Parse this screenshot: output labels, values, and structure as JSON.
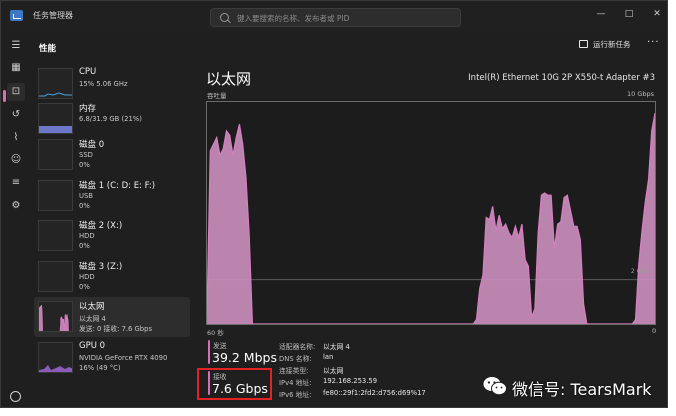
{
  "titlebar": {
    "title": "任务管理器",
    "search_placeholder": "键入要搜索的名称、发布者或 PID",
    "minimize": "—",
    "maximize": "□",
    "close": "✕"
  },
  "header": {
    "title": "性能",
    "run_task": "运行新任务",
    "more": "···"
  },
  "nav": {
    "icons": [
      "menu-icon",
      "processes-icon",
      "performance-icon",
      "app-history-icon",
      "startup-apps-icon",
      "users-icon",
      "details-icon",
      "services-icon",
      "settings-icon"
    ]
  },
  "devices": [
    {
      "name": "CPU",
      "l2": "15% 5.06 GHz",
      "l3": ""
    },
    {
      "name": "内存",
      "l2": "6.8/31.9 GB (21%)",
      "l3": ""
    },
    {
      "name": "磁盘 0",
      "l2": "SSD",
      "l3": "0%"
    },
    {
      "name": "磁盘 1 (C: D: E: F:)",
      "l2": "USB",
      "l3": "0%"
    },
    {
      "name": "磁盘 2 (X:)",
      "l2": "HDD",
      "l3": "0%"
    },
    {
      "name": "磁盘 3 (Z:)",
      "l2": "HDD",
      "l3": "0%"
    },
    {
      "name": "以太网",
      "l2": "以太网 4",
      "l3": "发送: 0 接收: 7.6 Gbps"
    },
    {
      "name": "GPU 0",
      "l2": "NVIDIA GeForce RTX 4090",
      "l3": "16% (49 °C)"
    }
  ],
  "ethernet": {
    "title": "以太网",
    "adapter": "Intel(R) Ethernet 10G 2P X550-t Adapter #3",
    "y_label": "吞吐量",
    "y_max": "10 Gbps",
    "grid_label": "2 Gbps",
    "x_left": "60 秒",
    "x_right": "0",
    "send_label": "发送",
    "send_value": "39.2 Mbps",
    "recv_label": "接收",
    "recv_value": "7.6 Gbps",
    "props": [
      {
        "k": "适配器名称:",
        "v": "以太网 4"
      },
      {
        "k": "DNS 名称:",
        "v": "lan"
      },
      {
        "k": "连接类型:",
        "v": "以太网"
      },
      {
        "k": "IPv4 地址:",
        "v": "192.168.253.59"
      },
      {
        "k": "IPv6 地址:",
        "v": "fe80::29f1:2fd2:d756:d69%17"
      }
    ]
  },
  "throughput_gbps": [
    0.4,
    7.8,
    8.1,
    8.4,
    7.6,
    7.9,
    8.7,
    8.5,
    7.6,
    8.4,
    9.0,
    8.1,
    6.6,
    4.0,
    0,
    0,
    0,
    0,
    0,
    0,
    0,
    0,
    0,
    0,
    0,
    0,
    0,
    0,
    0,
    0,
    0,
    0,
    0,
    0,
    0,
    0,
    0,
    0,
    0,
    0,
    0,
    0,
    0,
    0,
    0,
    0,
    0,
    0,
    0,
    0,
    0,
    0,
    0,
    0,
    0,
    0,
    0,
    0,
    0,
    0,
    0,
    0,
    0,
    0,
    0,
    0,
    0,
    0,
    0,
    0,
    0,
    0,
    0,
    0,
    0,
    0,
    0,
    0,
    0,
    0,
    0,
    0,
    0,
    0.2,
    1.6,
    2.2,
    4.8,
    4.7,
    5.3,
    4.2,
    4.9,
    4.3,
    4.5,
    4.1,
    3.9,
    4.4,
    3.9,
    4.5,
    2.9,
    2.6,
    0.3,
    0.7,
    4.1,
    5.8,
    5.9,
    5.8,
    5.8,
    3.4,
    4.5,
    4.6,
    5.7,
    5.8,
    5.1,
    4.4,
    4.4,
    3.8,
    0.9,
    0,
    0,
    0,
    0,
    0,
    0,
    0,
    0,
    0,
    0,
    0,
    0,
    0,
    0,
    0,
    0.2,
    2.7,
    4.2,
    5.5,
    6.5,
    8.7,
    9.5
  ],
  "colors": {
    "accent": "#d66fba",
    "graph_fill": "#c98dbc",
    "graph_line": "#d77ec1",
    "grid": "#5a5a5a",
    "highlight_box": "#e32323"
  },
  "watermark": "微信号: TearsMark"
}
